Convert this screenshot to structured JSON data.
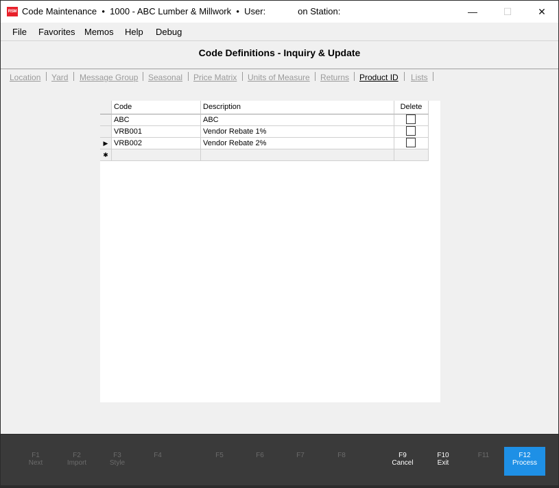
{
  "titlebar": {
    "app_icon_text": "RSM",
    "title": "Code Maintenance  •  1000 - ABC Lumber & Millwork  •  User:             on Station:",
    "minimize": "—",
    "maximize": "☐",
    "close": "✕"
  },
  "menu": {
    "items": [
      {
        "label": "File"
      },
      {
        "label": "Favorites"
      },
      {
        "label": "Memos"
      },
      {
        "label": "Help"
      },
      {
        "label": "Debug"
      }
    ]
  },
  "header": {
    "title": "Code Definitions - Inquiry & Update"
  },
  "tabs": [
    {
      "label": "Location",
      "active": false
    },
    {
      "label": "Yard",
      "active": false
    },
    {
      "label": "Message Group",
      "active": false
    },
    {
      "label": "Seasonal",
      "active": false
    },
    {
      "label": "Price Matrix",
      "active": false
    },
    {
      "label": "Units of Measure",
      "active": false
    },
    {
      "label": "Returns",
      "active": false
    },
    {
      "label": "Product ID",
      "active": true
    },
    {
      "label": "Lists",
      "active": false
    }
  ],
  "grid": {
    "columns": {
      "code": "Code",
      "description": "Description",
      "delete": "Delete"
    },
    "rows": [
      {
        "indicator": "",
        "code": "ABC",
        "description": "ABC",
        "delete": false
      },
      {
        "indicator": "",
        "code": "VRB001",
        "description": "Vendor Rebate 1%",
        "delete": false
      },
      {
        "indicator": "▶",
        "code": "VRB002",
        "description": "Vendor Rebate 2%",
        "delete": false
      }
    ],
    "new_row_indicator": "✱"
  },
  "fkeys": [
    {
      "key": "F1",
      "label": "Next"
    },
    {
      "key": "F2",
      "label": "Import"
    },
    {
      "key": "F3",
      "label": "Style"
    },
    {
      "key": "F4",
      "label": ""
    },
    {
      "key": "F5",
      "label": ""
    },
    {
      "key": "F6",
      "label": ""
    },
    {
      "key": "F7",
      "label": ""
    },
    {
      "key": "F8",
      "label": ""
    },
    {
      "key": "F9",
      "label": "Cancel"
    },
    {
      "key": "F10",
      "label": "Exit"
    },
    {
      "key": "F11",
      "label": ""
    },
    {
      "key": "F12",
      "label": "Process"
    }
  ],
  "colors": {
    "accent": "#1e90e6",
    "function_bar": "#3a3a3a",
    "app_icon": "#e8202a"
  }
}
